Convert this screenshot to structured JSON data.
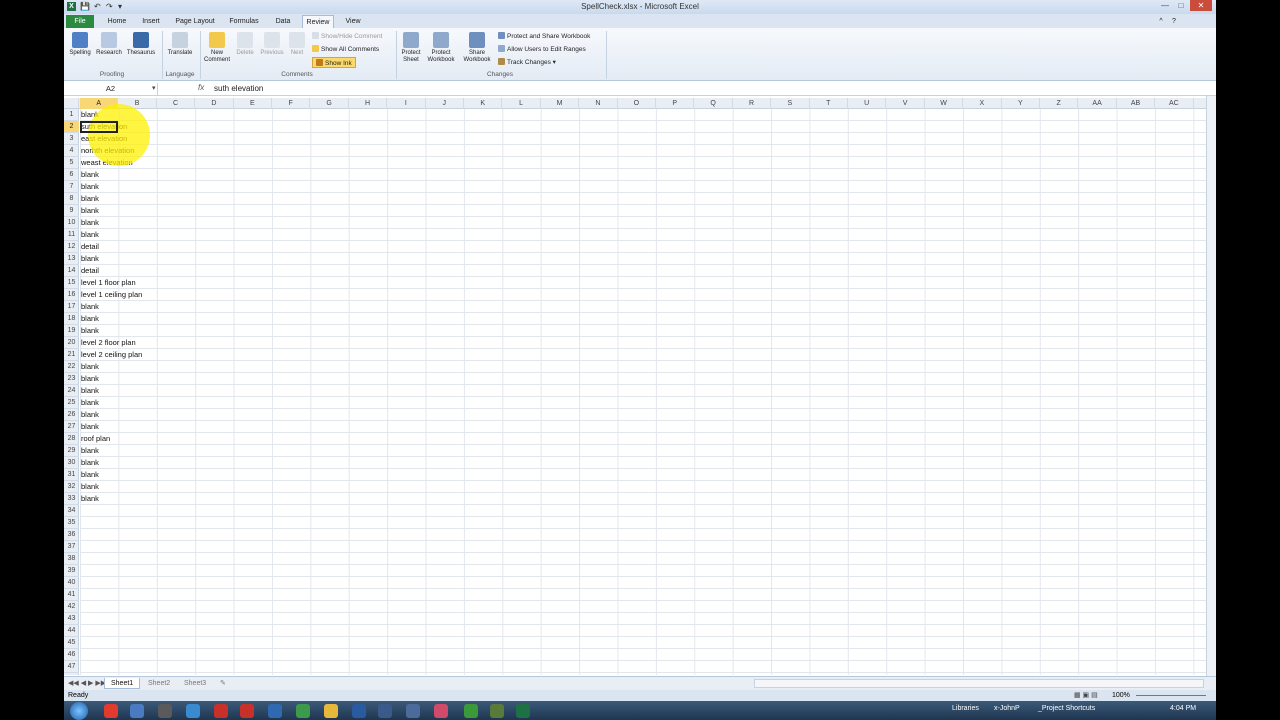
{
  "window": {
    "title": "SpellCheck.xlsx - Microsoft Excel",
    "app_icon": "X"
  },
  "tabs": [
    "File",
    "Home",
    "Insert",
    "Page Layout",
    "Formulas",
    "Data",
    "Review",
    "View"
  ],
  "ribbon": {
    "proofing": {
      "label": "Proofing",
      "spelling": "Spelling",
      "research": "Research",
      "thesaurus": "Thesaurus"
    },
    "language": {
      "label": "Language",
      "translate": "Translate"
    },
    "comments": {
      "label": "Comments",
      "new": "New Comment",
      "delete": "Delete",
      "previous": "Previous",
      "next": "Next",
      "show_hide": "Show/Hide Comment",
      "show_all": "Show All Comments",
      "show_ink": "Show Ink"
    },
    "changes": {
      "label": "Changes",
      "protect_sheet": "Protect Sheet",
      "protect_workbook": "Protect Workbook",
      "share_workbook": "Share Workbook",
      "protect_share": "Protect and Share Workbook",
      "allow_edit": "Allow Users to Edit Ranges",
      "track": "Track Changes"
    }
  },
  "formula_bar": {
    "name_box": "A2",
    "fx": "fx",
    "content": "suth elevation"
  },
  "columns": [
    "A",
    "B",
    "C",
    "D",
    "E",
    "F",
    "G",
    "H",
    "I",
    "J",
    "K",
    "L",
    "M",
    "N",
    "O",
    "P",
    "Q",
    "R",
    "S",
    "T",
    "U",
    "V",
    "W",
    "X",
    "Y",
    "Z",
    "AA",
    "AB",
    "AC"
  ],
  "rows": [
    "1",
    "2",
    "3",
    "4",
    "5",
    "6",
    "7",
    "8",
    "9",
    "10",
    "11",
    "12",
    "13",
    "14",
    "15",
    "16",
    "17",
    "18",
    "19",
    "20",
    "21",
    "22",
    "23",
    "24",
    "25",
    "26",
    "27",
    "28",
    "29",
    "30",
    "31",
    "32",
    "33",
    "34",
    "35",
    "36",
    "37",
    "38",
    "39",
    "40",
    "41",
    "42",
    "43",
    "44",
    "45",
    "46",
    "47"
  ],
  "cells_a": [
    "blank",
    "suth elevation",
    "east elevation",
    "norhth elevation",
    "weast elevation",
    "blank",
    "blank",
    "blank",
    "blank",
    "blank",
    "blank",
    "detail",
    "blank",
    "detail",
    "level 1 floor plan",
    "level 1 ceiling plan",
    "blank",
    "blank",
    "blank",
    "level 2 floor plan",
    "level 2 ceiling plan",
    "blank",
    "blank",
    "blank",
    "blank",
    "blank",
    "blank",
    "roof plan",
    "blank",
    "blank",
    "blank",
    "blank",
    "blank"
  ],
  "sheets": [
    "Sheet1",
    "Sheet2",
    "Sheet3"
  ],
  "status": {
    "ready": "Ready",
    "zoom": "100%"
  },
  "taskbar": {
    "libraries": "Libraries",
    "user": "x-JohnP",
    "shortcuts": "_Project Shortcuts",
    "time": "4:04 PM"
  }
}
